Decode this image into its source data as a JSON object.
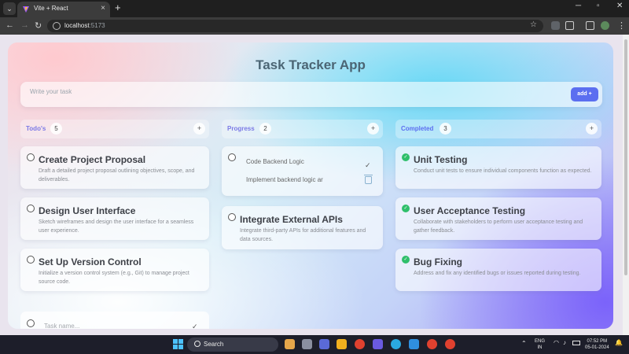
{
  "browser": {
    "tab_title": "Vite + React",
    "url_host": "localhost",
    "url_port": ":5173"
  },
  "app": {
    "title": "Task Tracker App",
    "input_placeholder": "Write your task",
    "add_label": "add +"
  },
  "columns": [
    {
      "title": "Todo's",
      "count": "5",
      "color": "#7b79e6",
      "cards": [
        {
          "title": "Create Project Proposal",
          "desc": "Draft a detailed project proposal outlining objectives, scope, and deliverables."
        },
        {
          "title": "Design User Interface",
          "desc": "Sketch wireframes and design the user interface for a seamless user experience."
        },
        {
          "title": "Set Up Version Control",
          "desc": "Initialize a version control system (e.g., Git) to manage project source code."
        }
      ],
      "new_task_placeholder": "Task name..."
    },
    {
      "title": "Progress",
      "count": "2",
      "color": "#7b79e6",
      "edit_card": {
        "title_value": "Code Backend Logic",
        "desc_value": "Implement backend logic ar"
      },
      "cards": [
        {
          "title": "Integrate External APIs",
          "desc": "Integrate third-party APIs for additional features and data sources."
        }
      ]
    },
    {
      "title": "Completed",
      "count": "3",
      "color": "#5b6ef0",
      "cards": [
        {
          "title": "Unit Testing",
          "desc": "Conduct unit tests to ensure individual components function as expected."
        },
        {
          "title": "User Acceptance Testing",
          "desc": "Collaborate with stakeholders to perform user acceptance testing and gather feedback."
        },
        {
          "title": "Bug Fixing",
          "desc": "Address and fix any identified bugs or issues reported during testing."
        }
      ]
    }
  ],
  "taskbar": {
    "search_label": "Search",
    "lang_line1": "ENG",
    "lang_line2": "IN",
    "time": "07:52 PM",
    "date": "05-01-2024"
  }
}
